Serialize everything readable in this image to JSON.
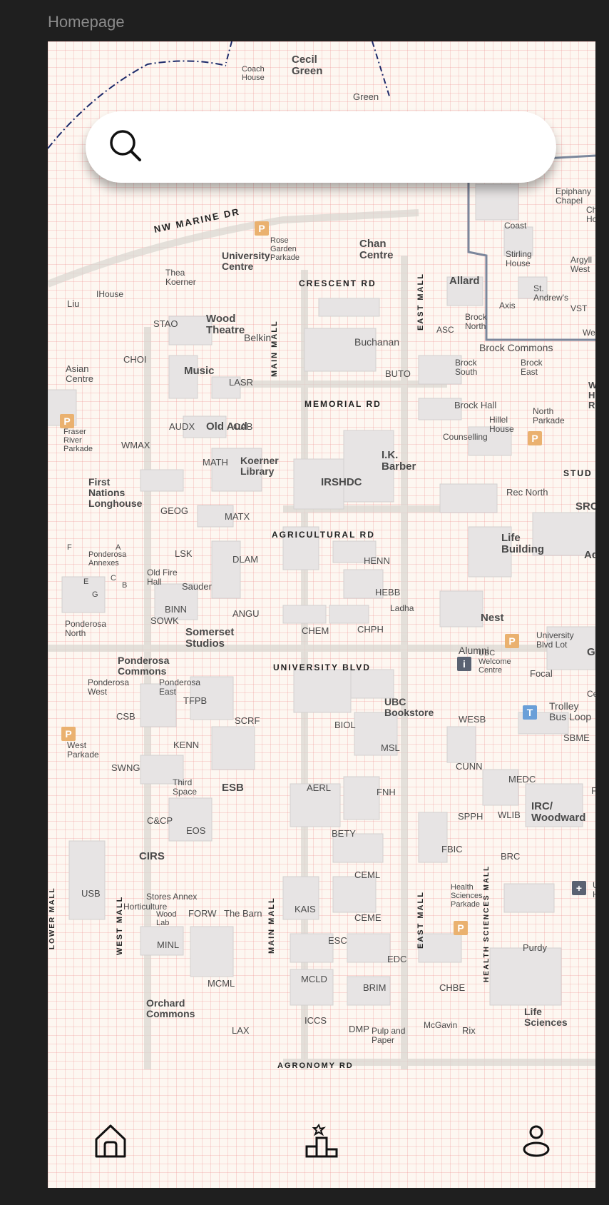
{
  "frame": {
    "title": "Homepage"
  },
  "search": {
    "placeholder": "",
    "value": "",
    "icon": "search-icon"
  },
  "map": {
    "roads": [
      {
        "id": "nw-marine-dr",
        "label": "NW MARINE DR"
      },
      {
        "id": "crescent-rd",
        "label": "CRESCENT RD"
      },
      {
        "id": "memorial-rd",
        "label": "MEMORIAL RD"
      },
      {
        "id": "agricultural-rd",
        "label": "AGRICULTURAL RD"
      },
      {
        "id": "university-blvd",
        "label": "UNIVERSITY BLVD"
      },
      {
        "id": "agronomy-rd",
        "label": "AGRONOMY RD"
      },
      {
        "id": "main-mall-north",
        "label": "MAIN MALL"
      },
      {
        "id": "main-mall-south",
        "label": "MAIN MALL"
      },
      {
        "id": "east-mall-north",
        "label": "EAST MALL"
      },
      {
        "id": "east-mall-south",
        "label": "EAST MALL"
      },
      {
        "id": "west-mall",
        "label": "WEST MALL"
      },
      {
        "id": "lower-mall",
        "label": "LOWER MALL"
      },
      {
        "id": "health-sciences-mall",
        "label": "HEALTH SCIENCES MALL"
      },
      {
        "id": "student",
        "label": "STUD"
      }
    ],
    "places": [
      {
        "id": "cecil-green",
        "label": "Cecil\nGreen"
      },
      {
        "id": "coach-house",
        "label": "Coach\nHouse"
      },
      {
        "id": "green-college",
        "label": "Green"
      },
      {
        "id": "epiphany-chapel",
        "label": "Epiphany\nChapel"
      },
      {
        "id": "chan-ho",
        "label": "Chan\nHo"
      },
      {
        "id": "coast",
        "label": "Coast"
      },
      {
        "id": "stirling-house",
        "label": "Stirling\nHouse"
      },
      {
        "id": "argyll-west",
        "label": "Argyll\nWest"
      },
      {
        "id": "axis",
        "label": "Axis"
      },
      {
        "id": "st-andrews",
        "label": "St.\nAndrew's"
      },
      {
        "id": "vst",
        "label": "VST"
      },
      {
        "id": "westp",
        "label": "Westp"
      },
      {
        "id": "rose-garden-parkade",
        "label": "Rose\nGarden\nParkade"
      },
      {
        "id": "chan-centre",
        "label": "Chan\nCentre"
      },
      {
        "id": "university-centre",
        "label": "University\nCentre"
      },
      {
        "id": "thea-koerner",
        "label": "Thea\nKoerner"
      },
      {
        "id": "ihouse",
        "label": "IHouse"
      },
      {
        "id": "liu",
        "label": "Liu"
      },
      {
        "id": "stao",
        "label": "STAO"
      },
      {
        "id": "wood-theatre",
        "label": "Wood\nTheatre"
      },
      {
        "id": "belkin",
        "label": "Belkin"
      },
      {
        "id": "allard",
        "label": "Allard"
      },
      {
        "id": "asc",
        "label": "ASC"
      },
      {
        "id": "brock-north",
        "label": "Brock\nNorth"
      },
      {
        "id": "brock-commons",
        "label": "Brock Commons"
      },
      {
        "id": "buchanan",
        "label": "Buchanan"
      },
      {
        "id": "choi",
        "label": "CHOI"
      },
      {
        "id": "asian-centre",
        "label": "Asian\nCentre"
      },
      {
        "id": "music",
        "label": "Music"
      },
      {
        "id": "lasr",
        "label": "LASR"
      },
      {
        "id": "buto",
        "label": "BUTO"
      },
      {
        "id": "brock-south",
        "label": "Brock\nSouth"
      },
      {
        "id": "brock-east",
        "label": "Brock\nEast"
      },
      {
        "id": "wh-residence",
        "label": "W\nH. G\nResi"
      },
      {
        "id": "brock-hall",
        "label": "Brock Hall"
      },
      {
        "id": "fraser-river-parkade",
        "label": "Fraser\nRiver\nParkade"
      },
      {
        "id": "wmax",
        "label": "WMAX"
      },
      {
        "id": "audx",
        "label": "AUDX"
      },
      {
        "id": "old-aud",
        "label": "Old Aud"
      },
      {
        "id": "oab",
        "label": "OAB"
      },
      {
        "id": "hillel-house",
        "label": "Hillel\nHouse"
      },
      {
        "id": "north-parkade",
        "label": "North\nParkade"
      },
      {
        "id": "counselling",
        "label": "Counselling"
      },
      {
        "id": "math",
        "label": "MATH"
      },
      {
        "id": "koerner-library",
        "label": "Koerner\nLibrary"
      },
      {
        "id": "ik-barber",
        "label": "I.K.\nBarber"
      },
      {
        "id": "irshdc",
        "label": "IRSHDC"
      },
      {
        "id": "first-nations-longhouse",
        "label": "First\nNations\nLonghouse"
      },
      {
        "id": "rec-north",
        "label": "Rec North"
      },
      {
        "id": "src",
        "label": "SRC"
      },
      {
        "id": "geog",
        "label": "GEOG"
      },
      {
        "id": "matx",
        "label": "MATX"
      },
      {
        "id": "life-building",
        "label": "Life\nBuilding"
      },
      {
        "id": "aquatic",
        "label": "Aquat"
      },
      {
        "id": "ponderosa-annexes",
        "label": "Ponderosa\nAnnexes"
      },
      {
        "id": "annex-f",
        "label": "F"
      },
      {
        "id": "annex-a",
        "label": "A"
      },
      {
        "id": "annex-e",
        "label": "E"
      },
      {
        "id": "annex-c",
        "label": "C"
      },
      {
        "id": "annex-b",
        "label": "B"
      },
      {
        "id": "annex-g",
        "label": "G"
      },
      {
        "id": "lsk",
        "label": "LSK"
      },
      {
        "id": "dlam",
        "label": "DLAM"
      },
      {
        "id": "henn",
        "label": "HENN"
      },
      {
        "id": "old-fire-hall",
        "label": "Old Fire\nHall"
      },
      {
        "id": "sauder",
        "label": "Sauder"
      },
      {
        "id": "hebb",
        "label": "HEBB"
      },
      {
        "id": "ladha",
        "label": "Ladha"
      },
      {
        "id": "binn",
        "label": "BINN"
      },
      {
        "id": "angu",
        "label": "ANGU"
      },
      {
        "id": "nest",
        "label": "Nest"
      },
      {
        "id": "ponderosa-north",
        "label": "Ponderosa\nNorth"
      },
      {
        "id": "sowk",
        "label": "SOWK"
      },
      {
        "id": "somerset-studios",
        "label": "Somerset\nStudios"
      },
      {
        "id": "chem",
        "label": "CHEM"
      },
      {
        "id": "chph",
        "label": "CHPH"
      },
      {
        "id": "university-blvd-lot",
        "label": "University\nBlvd Lot"
      },
      {
        "id": "alumni",
        "label": "Alumni"
      },
      {
        "id": "ubc-welcome-centre",
        "label": "UBC\nWelcome\nCentre"
      },
      {
        "id": "gym",
        "label": "Gy"
      },
      {
        "id": "ponderosa-commons",
        "label": "Ponderosa\nCommons"
      },
      {
        "id": "focal",
        "label": "Focal"
      },
      {
        "id": "ponderosa-west",
        "label": "Ponderosa\nWest"
      },
      {
        "id": "ponderosa-east",
        "label": "Ponderosa\nEast"
      },
      {
        "id": "tfpb",
        "label": "TFPB"
      },
      {
        "id": "cen",
        "label": "Cen"
      },
      {
        "id": "csb",
        "label": "CSB"
      },
      {
        "id": "scrf",
        "label": "SCRF"
      },
      {
        "id": "biol",
        "label": "BIOL"
      },
      {
        "id": "ubc-bookstore",
        "label": "UBC\nBookstore"
      },
      {
        "id": "wesb",
        "label": "WESB"
      },
      {
        "id": "trolley-bus-loop",
        "label": "Trolley\nBus Loop"
      },
      {
        "id": "west-parkade",
        "label": "West\nParkade"
      },
      {
        "id": "kenn",
        "label": "KENN"
      },
      {
        "id": "msl",
        "label": "MSL"
      },
      {
        "id": "sbme",
        "label": "SBME"
      },
      {
        "id": "swng",
        "label": "SWNG"
      },
      {
        "id": "cunn",
        "label": "CUNN"
      },
      {
        "id": "third-space",
        "label": "Third\nSpace"
      },
      {
        "id": "esb",
        "label": "ESB"
      },
      {
        "id": "aerl",
        "label": "AERL"
      },
      {
        "id": "fnh",
        "label": "FNH"
      },
      {
        "id": "medc",
        "label": "MEDC"
      },
      {
        "id": "f-edge",
        "label": "F"
      },
      {
        "id": "spph",
        "label": "SPPH"
      },
      {
        "id": "wlib",
        "label": "WLIB"
      },
      {
        "id": "irc-woodward",
        "label": "IRC/\nWoodward"
      },
      {
        "id": "ccp",
        "label": "C&CP"
      },
      {
        "id": "eos",
        "label": "EOS"
      },
      {
        "id": "bety",
        "label": "BETY"
      },
      {
        "id": "fbic",
        "label": "FBIC"
      },
      {
        "id": "brc",
        "label": "BRC"
      },
      {
        "id": "cirs",
        "label": "CIRS"
      },
      {
        "id": "ceml",
        "label": "CEML"
      },
      {
        "id": "u-hospital",
        "label": "U\nH"
      },
      {
        "id": "usb",
        "label": "USB"
      },
      {
        "id": "stores-annex",
        "label": "Stores Annex"
      },
      {
        "id": "horticulture",
        "label": "Horticulture"
      },
      {
        "id": "health-sciences-parkade",
        "label": "Health\nSciences\nParkade"
      },
      {
        "id": "wood-lab",
        "label": "Wood\nLab"
      },
      {
        "id": "forw",
        "label": "FORW"
      },
      {
        "id": "the-barn",
        "label": "The Barn"
      },
      {
        "id": "kais",
        "label": "KAIS"
      },
      {
        "id": "ceme",
        "label": "CEME"
      },
      {
        "id": "minl",
        "label": "MINL"
      },
      {
        "id": "esc",
        "label": "ESC"
      },
      {
        "id": "purdy",
        "label": "Purdy"
      },
      {
        "id": "edc",
        "label": "EDC"
      },
      {
        "id": "mcml",
        "label": "MCML"
      },
      {
        "id": "mcld",
        "label": "MCLD"
      },
      {
        "id": "brim",
        "label": "BRIM"
      },
      {
        "id": "chbe",
        "label": "CHBE"
      },
      {
        "id": "orchard-commons",
        "label": "Orchard\nCommons"
      },
      {
        "id": "iccs",
        "label": "ICCS"
      },
      {
        "id": "lax",
        "label": "LAX"
      },
      {
        "id": "dmp",
        "label": "DMP"
      },
      {
        "id": "pulp-and-paper",
        "label": "Pulp and\nPaper"
      },
      {
        "id": "mcgavin",
        "label": "McGavin"
      },
      {
        "id": "rix",
        "label": "Rix"
      },
      {
        "id": "life-sciences",
        "label": "Life\nSciences"
      }
    ],
    "markers": [
      {
        "id": "parking-rose-garden",
        "type": "parking",
        "symbol": "P",
        "color": "#eab16f"
      },
      {
        "id": "parking-fraser-river",
        "type": "parking",
        "symbol": "P",
        "color": "#eab16f"
      },
      {
        "id": "parking-north",
        "type": "parking",
        "symbol": "P",
        "color": "#eab16f"
      },
      {
        "id": "parking-university-blvd",
        "type": "parking",
        "symbol": "P",
        "color": "#eab16f"
      },
      {
        "id": "parking-west",
        "type": "parking",
        "symbol": "P",
        "color": "#eab16f"
      },
      {
        "id": "parking-health-sciences",
        "type": "parking",
        "symbol": "P",
        "color": "#eab16f"
      },
      {
        "id": "info-welcome-centre",
        "type": "info",
        "symbol": "i",
        "color": "#5a6272"
      },
      {
        "id": "transit-trolley-loop",
        "type": "transit",
        "symbol": "T",
        "color": "#6a9fd8"
      },
      {
        "id": "hospital",
        "type": "hospital",
        "symbol": "+",
        "color": "#5a6272"
      }
    ]
  },
  "nav": {
    "items": [
      {
        "id": "home",
        "label": "Home",
        "icon": "home-icon"
      },
      {
        "id": "leaderboard",
        "label": "Leaderboard",
        "icon": "podium-icon"
      },
      {
        "id": "profile",
        "label": "Profile",
        "icon": "user-icon"
      }
    ]
  },
  "colors": {
    "app_background": "#1f1f1f",
    "map_background": "#fdf7f1",
    "grid_line": "#ec8c8c",
    "building_fill": "#e7e4e4",
    "parking": "#eab16f",
    "boundary_line": "#1c2a6a"
  }
}
